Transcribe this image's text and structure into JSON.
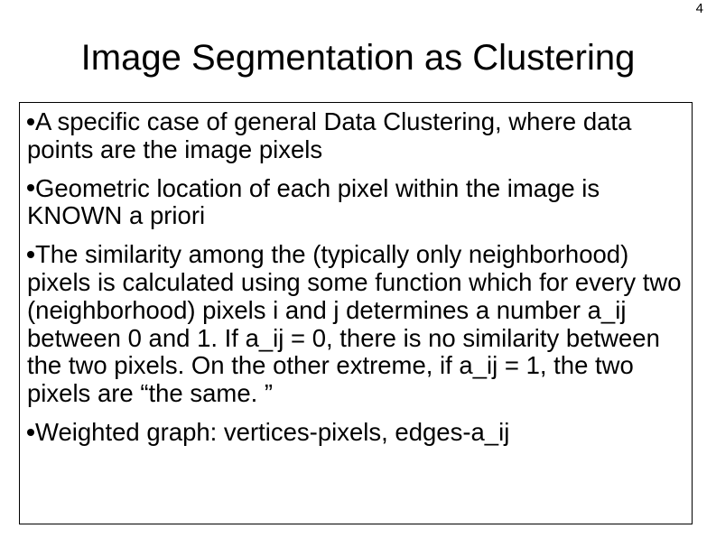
{
  "page_number": "4",
  "title": "Image Segmentation as Clustering",
  "bullets": [
    "A specific case of general Data Clustering, where data points are the image pixels",
    "Geometric location of each pixel within the image is KNOWN a priori",
    "The similarity among the (typically only neighborhood) pixels is calculated using some function which for every two (neighborhood) pixels i and j determines a number a_ij between 0 and 1. If a_ij = 0, there is no similarity between the two pixels. On the other extreme, if a_ij = 1, the two pixels are “the same. ”",
    "Weighted graph: vertices-pixels, edges-a_ij"
  ]
}
